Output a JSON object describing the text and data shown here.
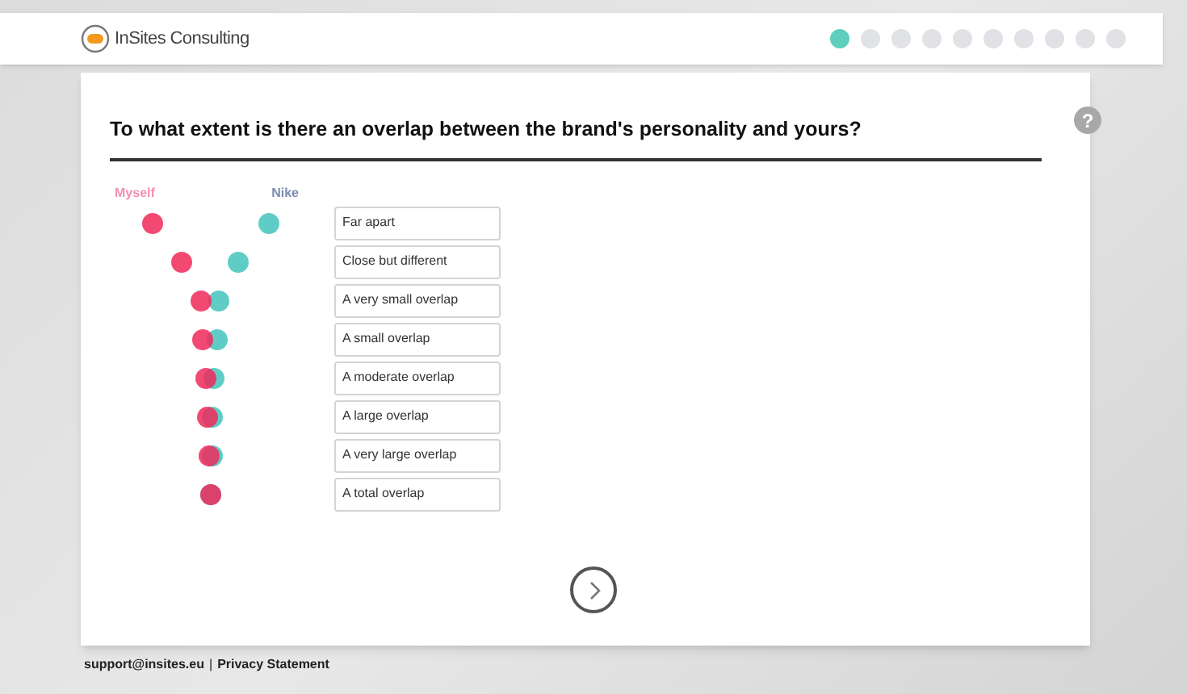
{
  "header": {
    "logo_text": "InSites Consulting",
    "progress": [
      {
        "selected": true
      },
      {
        "selected": false
      },
      {
        "selected": false
      },
      {
        "selected": false
      },
      {
        "selected": false
      },
      {
        "selected": false
      },
      {
        "selected": false
      },
      {
        "selected": false
      },
      {
        "selected": false
      },
      {
        "selected": false
      }
    ]
  },
  "question": {
    "title": "To what extent is there an overlap between the brand's personality and yours?",
    "help": "?"
  },
  "legend": {
    "self": "Myself",
    "brand": "Nike"
  },
  "options": [
    {
      "label": "Far apart"
    },
    {
      "label": "Close but different"
    },
    {
      "label": "A very small overlap"
    },
    {
      "label": "A small overlap"
    },
    {
      "label": "A moderate overlap"
    },
    {
      "label": "A large overlap"
    },
    {
      "label": "A very large overlap"
    },
    {
      "label": "A total overlap"
    }
  ],
  "footer": {
    "email": "support@insites.eu",
    "separator": "|",
    "privacy": "Privacy Statement"
  }
}
